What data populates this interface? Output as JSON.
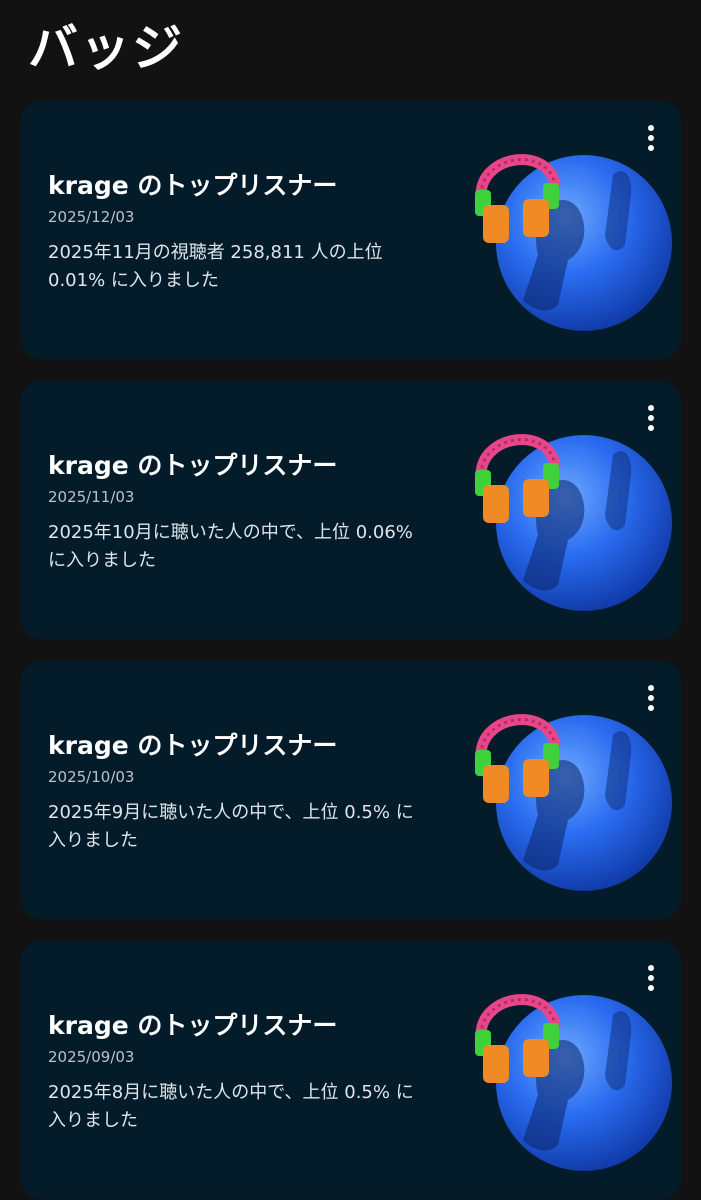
{
  "page": {
    "title": "バッジ"
  },
  "badges": [
    {
      "title": "krage のトップリスナー",
      "date": "2025/12/03",
      "description": "2025年11月の視聴者 258,811 人の上位 0.01% に入りました"
    },
    {
      "title": "krage のトップリスナー",
      "date": "2025/11/03",
      "description": "2025年10月に聴いた人の中で、上位 0.06% に入りました"
    },
    {
      "title": "krage のトップリスナー",
      "date": "2025/10/03",
      "description": "2025年9月に聴いた人の中で、上位 0.5% に入りました"
    },
    {
      "title": "krage のトップリスナー",
      "date": "2025/09/03",
      "description": "2025年8月に聴いた人の中で、上位 0.5% に入りました"
    }
  ],
  "colors": {
    "background": "#121212",
    "card": "#041c2a",
    "badge_blue": "#1d5fe0",
    "headphone_band": "#e8468a",
    "headphone_green": "#3ed13a",
    "headphone_orange": "#f08a24"
  },
  "icons": {
    "menu": "more-vert-icon",
    "badge": "headphones-badge-icon"
  }
}
